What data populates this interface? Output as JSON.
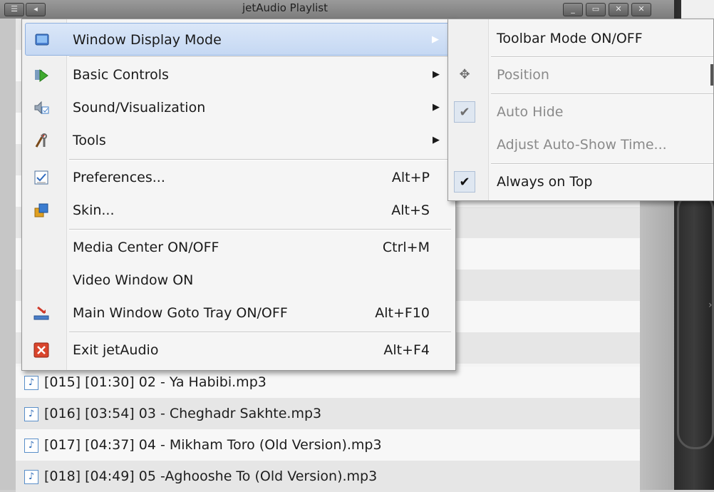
{
  "window": {
    "title": "jetAudio Playlist",
    "buttons": [
      "_",
      "▭",
      "✕",
      "✕"
    ],
    "left_buttons": [
      "☰",
      "◂"
    ]
  },
  "playlist": {
    "rows": [
      {
        "text": "[015] [01:30]  02 - Ya Habibi.mp3"
      },
      {
        "text": "[016] [03:54]  03 - Cheghadr Sakhte.mp3"
      },
      {
        "text": "[017] [04:37]  04 - Mikham Toro (Old Version).mp3"
      },
      {
        "text": "[018] [04:49]  05 -Aghooshe To (Old Version).mp3"
      }
    ]
  },
  "menu": {
    "items": [
      {
        "label": "Window Display Mode",
        "icon": "monitor-icon",
        "arrow": "▶"
      },
      {
        "label": "Basic Controls",
        "icon": "play-green-icon",
        "arrow": "▶"
      },
      {
        "label": "Sound/Visualization",
        "icon": "speaker-icon",
        "arrow": "▶"
      },
      {
        "label": "Tools",
        "icon": "tools-icon",
        "arrow": "▶"
      },
      {
        "label": "Preferences...",
        "icon": "checklist-icon",
        "shortcut": "Alt+P"
      },
      {
        "label": "Skin...",
        "icon": "skin-icon",
        "shortcut": "Alt+S"
      },
      {
        "label": "Media Center ON/OFF",
        "shortcut": "Ctrl+M"
      },
      {
        "label": "Video Window ON"
      },
      {
        "label": "Main Window Goto Tray ON/OFF",
        "icon": "tray-icon",
        "shortcut": "Alt+F10"
      },
      {
        "label": "Exit jetAudio",
        "icon": "exit-icon",
        "shortcut": "Alt+F4"
      }
    ]
  },
  "submenu": {
    "items": [
      {
        "label": "Toolbar Mode ON/OFF"
      },
      {
        "label": "Position",
        "icon": "move-icon",
        "disabled": true
      },
      {
        "label": "Auto Hide",
        "checked": true,
        "disabled": true
      },
      {
        "label": "Adjust Auto-Show Time...",
        "disabled": true
      },
      {
        "label": "Always on Top",
        "checked": true
      }
    ]
  },
  "colors": {
    "highlight": "#c5d8f3",
    "exit_red": "#d9452c",
    "note_blue": "#2e6bb8"
  }
}
